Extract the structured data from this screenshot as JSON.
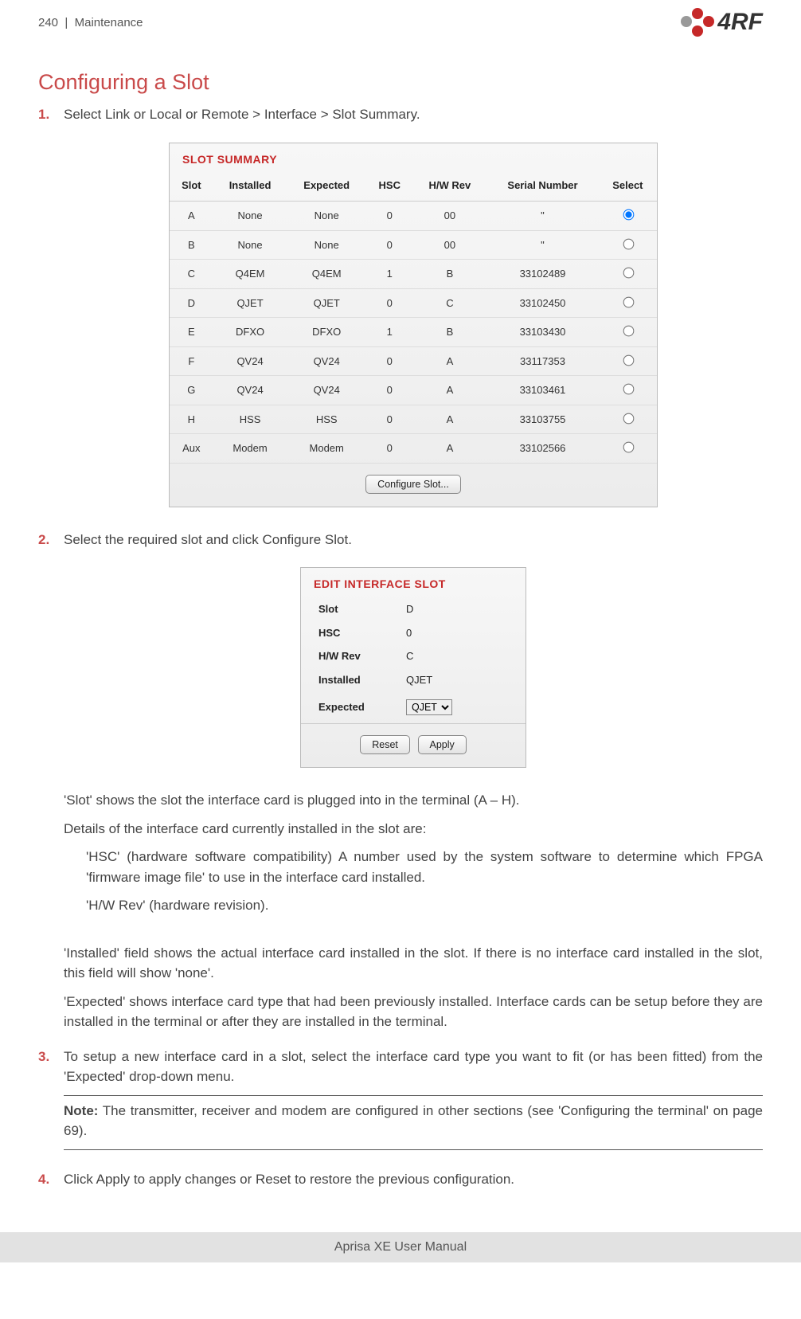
{
  "header": {
    "page_num": "240",
    "section": "Maintenance",
    "logo_text": "4RF"
  },
  "title": "Configuring a Slot",
  "steps": {
    "s1": "Select Link or Local or Remote > Interface > Slot Summary.",
    "s2": "Select the required slot and click Configure Slot.",
    "s3": "To setup a new interface card in a slot, select the interface card type you want to fit (or has been fitted) from the 'Expected' drop-down menu.",
    "s4": "Click Apply to apply changes or Reset to restore the previous configuration."
  },
  "slot_summary": {
    "title": "SLOT SUMMARY",
    "cols": [
      "Slot",
      "Installed",
      "Expected",
      "HSC",
      "H/W Rev",
      "Serial Number",
      "Select"
    ],
    "rows": [
      {
        "slot": "A",
        "installed": "None",
        "expected": "None",
        "hsc": "0",
        "rev": "00",
        "serial": "\"",
        "sel": true
      },
      {
        "slot": "B",
        "installed": "None",
        "expected": "None",
        "hsc": "0",
        "rev": "00",
        "serial": "\"",
        "sel": false
      },
      {
        "slot": "C",
        "installed": "Q4EM",
        "expected": "Q4EM",
        "hsc": "1",
        "rev": "B",
        "serial": "33102489",
        "sel": false
      },
      {
        "slot": "D",
        "installed": "QJET",
        "expected": "QJET",
        "hsc": "0",
        "rev": "C",
        "serial": "33102450",
        "sel": false
      },
      {
        "slot": "E",
        "installed": "DFXO",
        "expected": "DFXO",
        "hsc": "1",
        "rev": "B",
        "serial": "33103430",
        "sel": false
      },
      {
        "slot": "F",
        "installed": "QV24",
        "expected": "QV24",
        "hsc": "0",
        "rev": "A",
        "serial": "33117353",
        "sel": false
      },
      {
        "slot": "G",
        "installed": "QV24",
        "expected": "QV24",
        "hsc": "0",
        "rev": "A",
        "serial": "33103461",
        "sel": false
      },
      {
        "slot": "H",
        "installed": "HSS",
        "expected": "HSS",
        "hsc": "0",
        "rev": "A",
        "serial": "33103755",
        "sel": false
      },
      {
        "slot": "Aux",
        "installed": "Modem",
        "expected": "Modem",
        "hsc": "0",
        "rev": "A",
        "serial": "33102566",
        "sel": false
      }
    ],
    "button": "Configure Slot..."
  },
  "edit_slot": {
    "title": "EDIT INTERFACE SLOT",
    "labels": {
      "slot": "Slot",
      "hsc": "HSC",
      "rev": "H/W Rev",
      "installed": "Installed",
      "expected": "Expected"
    },
    "values": {
      "slot": "D",
      "hsc": "0",
      "rev": "C",
      "installed": "QJET",
      "expected": "QJET"
    },
    "buttons": {
      "reset": "Reset",
      "apply": "Apply"
    }
  },
  "body": {
    "p1": "'Slot' shows the slot the interface card is plugged into in the terminal (A – H).",
    "p2": "Details of the interface card currently installed in the slot are:",
    "p3": "'HSC' (hardware software compatibility) A number used by the system software to determine which FPGA 'firmware image file' to use in the interface card installed.",
    "p4": "'H/W Rev' (hardware revision).",
    "p5": "'Installed' field shows the actual interface card installed in the slot. If there is no interface card installed in the slot, this field will show 'none'.",
    "p6": "'Expected' shows interface card type that had been previously installed. Interface cards can be setup before they are installed in the terminal or after they are installed in the terminal.",
    "note": "Note: The transmitter, receiver and modem are configured in other sections (see 'Configuring the terminal' on page 69)."
  },
  "footer": "Aprisa XE User Manual"
}
